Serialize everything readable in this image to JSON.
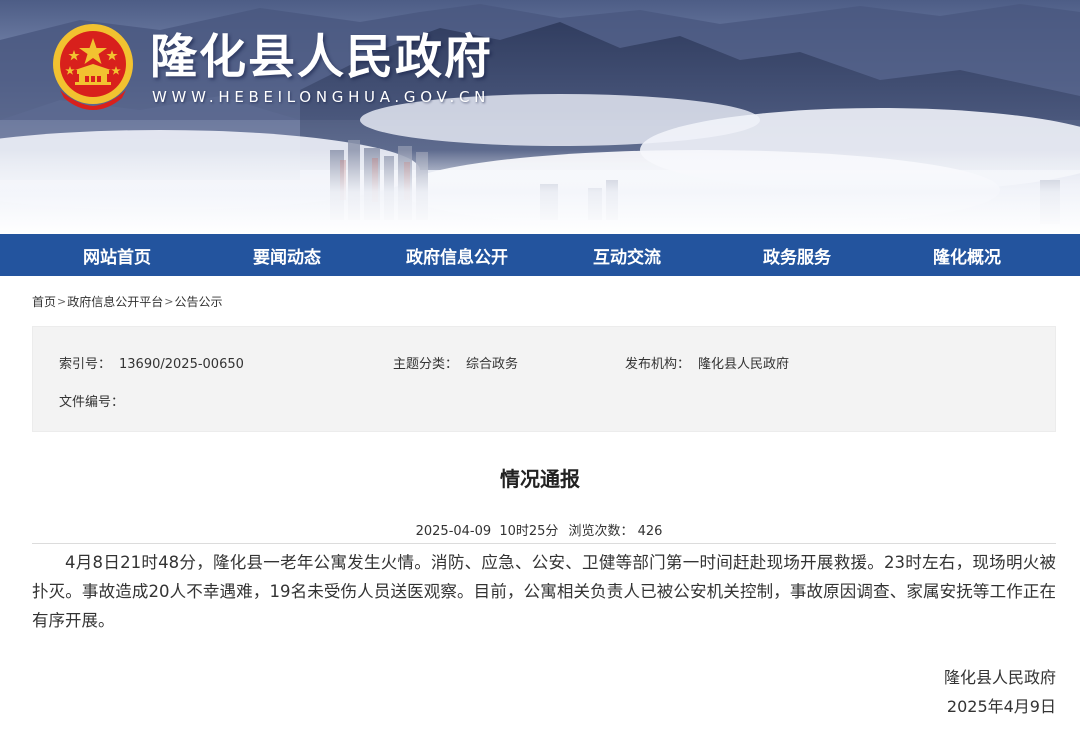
{
  "header": {
    "site_title": "隆化县人民政府",
    "site_url": "WWW.HEBEILONGHUA.GOV.CN"
  },
  "nav": {
    "items": [
      {
        "label": "网站首页"
      },
      {
        "label": "要闻动态"
      },
      {
        "label": "政府信息公开"
      },
      {
        "label": "互动交流"
      },
      {
        "label": "政务服务"
      },
      {
        "label": "隆化概况"
      }
    ]
  },
  "breadcrumb": {
    "items": [
      "首页",
      "政府信息公开平台",
      "公告公示"
    ],
    "separator": ">"
  },
  "info": {
    "index_label": "索引号：",
    "index_value": "13690/2025-00650",
    "topic_label": "主题分类：",
    "topic_value": "综合政务",
    "publisher_label": "发布机构：",
    "publisher_value": "隆化县人民政府",
    "doc_no_label": "文件编号：",
    "doc_no_value": ""
  },
  "article": {
    "title": "情况通报",
    "date": "2025-04-09",
    "time": "10时25分",
    "views_label": "浏览次数：",
    "views": "426",
    "body": "4月8日21时48分，隆化县一老年公寓发生火情。消防、应急、公安、卫健等部门第一时间赶赴现场开展救援。23时左右，现场明火被扑灭。事故造成20人不幸遇难，19名未受伤人员送医观察。目前，公寓相关负责人已被公安机关控制，事故原因调查、家属安抚等工作正在有序开展。",
    "signature_org": "隆化县人民政府",
    "signature_date": "2025年4月9日"
  },
  "colors": {
    "nav_bg": "#23549e",
    "emblem_red": "#d8201c",
    "emblem_gold": "#f2c230"
  }
}
